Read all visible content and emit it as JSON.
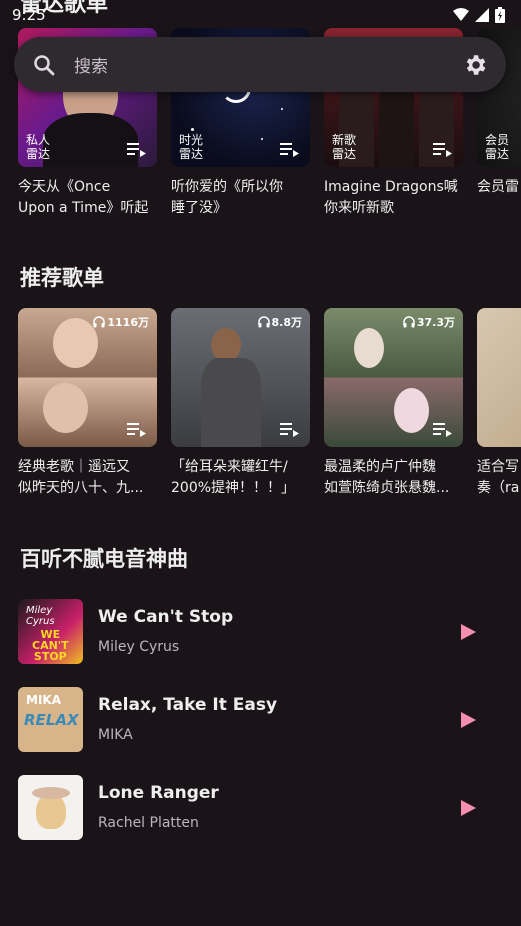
{
  "status_bar": {
    "time": "9:25"
  },
  "clipped_header": "雷达歌单",
  "search": {
    "placeholder": "搜索"
  },
  "radar": {
    "cards": [
      {
        "label": "私人\n雷达",
        "title": "今天从《Once\nUpon a Time》听起"
      },
      {
        "label": "时光\n雷达",
        "title": "听你爱的《所以你\n睡了没》"
      },
      {
        "label": "新歌\n雷达",
        "title": "Imagine Dragons喊\n你来听新歌"
      },
      {
        "label": "会员\n雷达",
        "title": "会员雷"
      }
    ]
  },
  "recommended": {
    "title": "推荐歌单",
    "cards": [
      {
        "plays": "1116万",
        "title": "经典老歌｜遥远又\n似昨天的八十、九..."
      },
      {
        "plays": "8.8万",
        "title": "「给耳朵来罐红牛/\n200%提神！！！」"
      },
      {
        "plays": "37.3万",
        "title": "最温柔的卢广仲魏\n如萱陈绮贞张悬魏..."
      },
      {
        "plays": "",
        "title": "适合写\n奏（ra"
      }
    ]
  },
  "electronic": {
    "title": "百听不腻电音神曲",
    "songs": [
      {
        "title": "We Can't Stop",
        "artist": "Miley Cyrus"
      },
      {
        "title": "Relax, Take It Easy",
        "artist": "MIKA"
      },
      {
        "title": "Lone Ranger",
        "artist": "Rachel Platten"
      }
    ]
  },
  "colors": {
    "background": "#1a1418",
    "accent": "#f48fb1",
    "search_bg": "#2f2930"
  }
}
